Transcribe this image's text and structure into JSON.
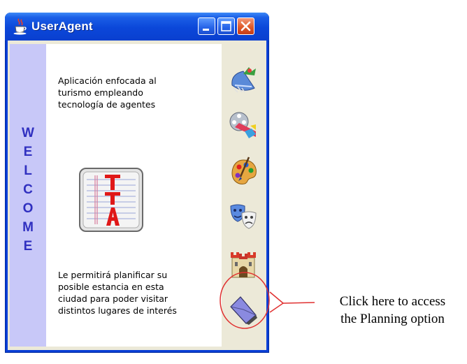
{
  "window": {
    "title": "UserAgent",
    "icons": [
      "java-cup-icon",
      "minimize-icon",
      "maximize-icon",
      "close-icon"
    ]
  },
  "welcome": {
    "letters": [
      "W",
      "E",
      "L",
      "C",
      "O",
      "M",
      "E"
    ]
  },
  "panel": {
    "intro_lines": [
      "Aplicación enfocada al",
      "turismo empleando",
      "tecnología de agentes"
    ],
    "logo": "tta-logo",
    "description_lines": [
      "Le permitirá planificar su",
      "posible estancia en esta",
      "ciudad para poder visitar",
      "distintos lugares de interés"
    ]
  },
  "sidebar": {
    "icons": [
      "fish-food-icon",
      "film-reel-icon",
      "painter-palette-icon",
      "theater-masks-icon",
      "castle-icon",
      "planning-folder-icon"
    ]
  },
  "annotation": {
    "lines": [
      "Click here to access",
      "the Planning option"
    ]
  },
  "colors": {
    "titlebar": "#0b47d9",
    "welcome_band": "#c8c8f8",
    "welcome_text": "#3030c0",
    "callout": "#e03030"
  }
}
